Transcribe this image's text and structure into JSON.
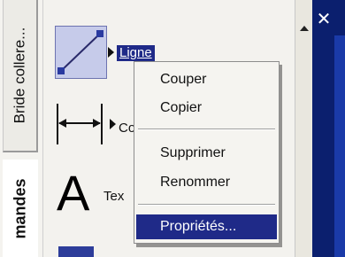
{
  "tabs": {
    "inactive_label": "Bride collere...",
    "active_label": "mandes"
  },
  "palette": {
    "tools": [
      {
        "label": "Ligne",
        "icon": "line-tool-icon"
      },
      {
        "label": "Co",
        "icon": "dimension-tool-icon"
      },
      {
        "label": "Tex",
        "icon": "text-tool-icon"
      }
    ],
    "text_icon_glyph": "A"
  },
  "window": {
    "close_glyph": "✕"
  },
  "context_menu": {
    "items": [
      {
        "label": "Couper"
      },
      {
        "label": "Copier"
      },
      {
        "label": "Supprimer"
      },
      {
        "label": "Renommer"
      },
      {
        "label": "Propriétés..."
      }
    ],
    "selected_index": 4
  },
  "colors": {
    "selection": "#1f2a88",
    "title_bar": "#0b1f6e"
  }
}
